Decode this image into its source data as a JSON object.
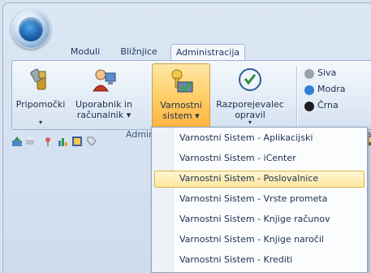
{
  "tabs": [
    {
      "label": "Moduli"
    },
    {
      "label": "Bližnjice"
    },
    {
      "label": "Administracija"
    }
  ],
  "ribbon": {
    "buttons": [
      {
        "label1": "Pripomočki",
        "label2": "",
        "arrow": "▾",
        "icon": "tools-icon"
      },
      {
        "label1": "Uporabnik in",
        "label2": "računalnik ▾",
        "arrow": "",
        "icon": "user-computer-icon"
      },
      {
        "label1": "Varnostni",
        "label2": "sistem ▾",
        "arrow": "",
        "icon": "security-system-icon"
      },
      {
        "label1": "Razporejevalec",
        "label2": "opravil",
        "arrow": "▾",
        "icon": "scheduler-icon"
      }
    ],
    "group_label": "Admin",
    "colors": [
      {
        "label": "Siva",
        "color": "#9aa3ad"
      },
      {
        "label": "Modra",
        "color": "#2f7fd6"
      },
      {
        "label": "Črna",
        "color": "#1d1d1d"
      }
    ],
    "partial_group_label": "as"
  },
  "dropdown": {
    "items": [
      {
        "label": "Varnostni Sistem - Aplikacijski",
        "highlighted": false
      },
      {
        "label": "Varnostni Sistem - iCenter",
        "highlighted": false
      },
      {
        "label": "Varnostni Sistem - Poslovalnice",
        "highlighted": true
      },
      {
        "label": "Varnostni Sistem - Vrste prometa",
        "highlighted": false
      },
      {
        "label": "Varnostni Sistem - Knjige računov",
        "highlighted": false
      },
      {
        "label": "Varnostni Sistem - Knjige naročil",
        "highlighted": false
      },
      {
        "label": "Varnostni Sistem - Krediti",
        "highlighted": false
      }
    ]
  }
}
